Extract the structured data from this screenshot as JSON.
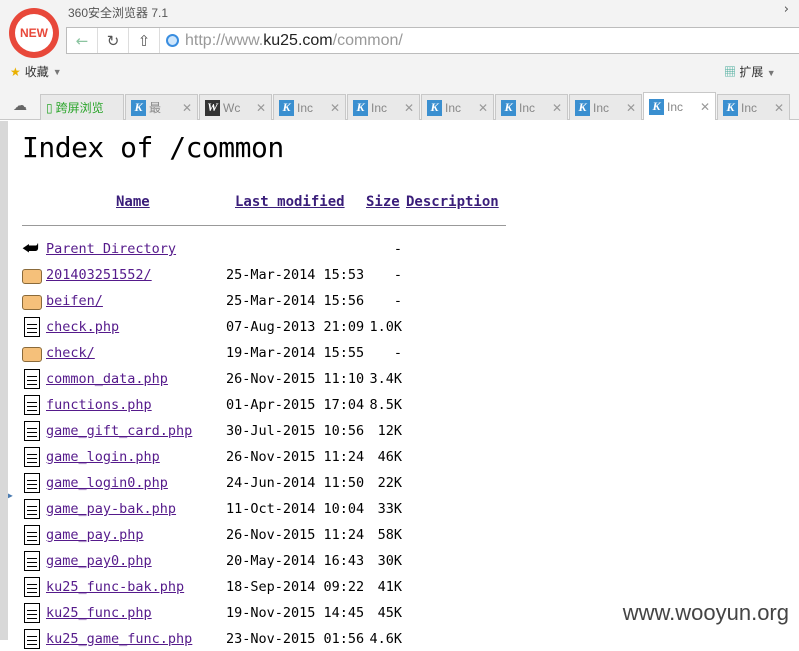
{
  "browser": {
    "title": "360安全浏览器 7.1",
    "logo": "NEW",
    "url_prefix": "http://www.",
    "url_domain": "ku25.com",
    "url_path": "/common/",
    "bookmarks_label": "收藏",
    "extensions_label": "扩展",
    "tabs": [
      {
        "label": "跨屏浏览",
        "icon": "phone-icon"
      },
      {
        "label": "最",
        "icon": "k-icon"
      },
      {
        "label": "Wc",
        "icon": "w-icon"
      },
      {
        "label": "Inc",
        "icon": "k-icon"
      },
      {
        "label": "Inc",
        "icon": "k-icon"
      },
      {
        "label": "Inc",
        "icon": "k-icon"
      },
      {
        "label": "Inc",
        "icon": "k-icon"
      },
      {
        "label": "Inc",
        "icon": "k-icon"
      },
      {
        "label": "Inc",
        "icon": "k-icon",
        "active": true
      },
      {
        "label": "Inc",
        "icon": "k-icon"
      }
    ]
  },
  "page": {
    "title": "Index of /common",
    "headers": {
      "name": "Name",
      "modified": "Last modified",
      "size": "Size",
      "description": "Description"
    },
    "rows": [
      {
        "name": "Parent Directory",
        "date": "",
        "size": "-",
        "type": "back"
      },
      {
        "name": "201403251552/",
        "date": "25-Mar-2014 15:53",
        "size": "-",
        "type": "folder"
      },
      {
        "name": "beifen/",
        "date": "25-Mar-2014 15:56",
        "size": "-",
        "type": "folder"
      },
      {
        "name": "check.php",
        "date": "07-Aug-2013 21:09",
        "size": "1.0K",
        "type": "file"
      },
      {
        "name": "check/",
        "date": "19-Mar-2014 15:55",
        "size": "-",
        "type": "folder"
      },
      {
        "name": "common_data.php",
        "date": "26-Nov-2015 11:10",
        "size": "3.4K",
        "type": "file"
      },
      {
        "name": "functions.php",
        "date": "01-Apr-2015 17:04",
        "size": "8.5K",
        "type": "file"
      },
      {
        "name": "game_gift_card.php",
        "date": "30-Jul-2015 10:56",
        "size": "12K",
        "type": "file"
      },
      {
        "name": "game_login.php",
        "date": "26-Nov-2015 11:24",
        "size": "46K",
        "type": "file"
      },
      {
        "name": "game_login0.php",
        "date": "24-Jun-2014 11:50",
        "size": "22K",
        "type": "file"
      },
      {
        "name": "game_pay-bak.php",
        "date": "11-Oct-2014 10:04",
        "size": "33K",
        "type": "file"
      },
      {
        "name": "game_pay.php",
        "date": "26-Nov-2015 11:24",
        "size": "58K",
        "type": "file"
      },
      {
        "name": "game_pay0.php",
        "date": "20-May-2014 16:43",
        "size": "30K",
        "type": "file"
      },
      {
        "name": "ku25_func-bak.php",
        "date": "18-Sep-2014 09:22",
        "size": "41K",
        "type": "file"
      },
      {
        "name": "ku25_func.php",
        "date": "19-Nov-2015 14:45",
        "size": "45K",
        "type": "file"
      },
      {
        "name": "ku25_game_func.php",
        "date": "23-Nov-2015 01:56",
        "size": "4.6K",
        "type": "file"
      }
    ]
  },
  "watermark": "www.wooyun.org"
}
